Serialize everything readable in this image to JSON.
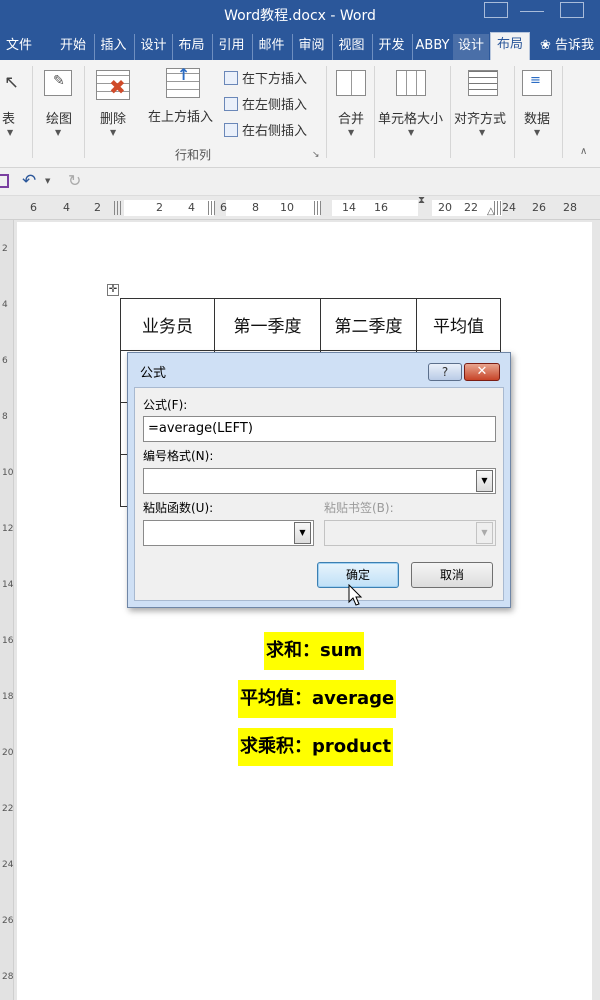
{
  "window": {
    "title": "Word教程.docx - Word"
  },
  "tabs": [
    "文件",
    "开始",
    "插入",
    "设计",
    "布局",
    "引用",
    "邮件",
    "审阅",
    "视图",
    "开发",
    "ABBY",
    "设计",
    "布局"
  ],
  "tell_me": "告诉我",
  "ribbon": {
    "table_label": "表",
    "draw_label": "绘图",
    "delete_label": "删除",
    "insert_above": "在上方插入",
    "insert_below": "在下方插入",
    "insert_left": "在左侧插入",
    "insert_right": "在右侧插入",
    "rows_cols_group": "行和列",
    "merge_label": "合并",
    "cell_size_label": "单元格大小",
    "align_label": "对齐方式",
    "data_label": "数据"
  },
  "ruler": {
    "numbers": [
      "6",
      "4",
      "2",
      "2",
      "4",
      "6",
      "8",
      "10",
      "14",
      "16",
      "20",
      "22",
      "24",
      "26",
      "28"
    ]
  },
  "vruler_numbers": [
    "2",
    "4",
    "6",
    "8",
    "10",
    "12",
    "14",
    "16",
    "18",
    "20",
    "22",
    "24",
    "26",
    "28"
  ],
  "table": {
    "headers": [
      "业务员",
      "第一季度",
      "第二季度",
      "平均值"
    ]
  },
  "dialog": {
    "title": "公式",
    "help": "?",
    "formula_label": "公式(F):",
    "formula_value": "=average(LEFT)",
    "format_label": "编号格式(N):",
    "format_value": "",
    "paste_function_label": "粘贴函数(U):",
    "paste_bookmark_label": "粘贴书签(B):",
    "ok": "确定",
    "cancel": "取消"
  },
  "notes": {
    "sum": "求和：sum",
    "average": "平均值：average",
    "product": "求乘积：product"
  },
  "colors": {
    "title_bar": "#2b579a",
    "highlight": "#ffff00",
    "dialog_frame": "#cfe0f5"
  }
}
